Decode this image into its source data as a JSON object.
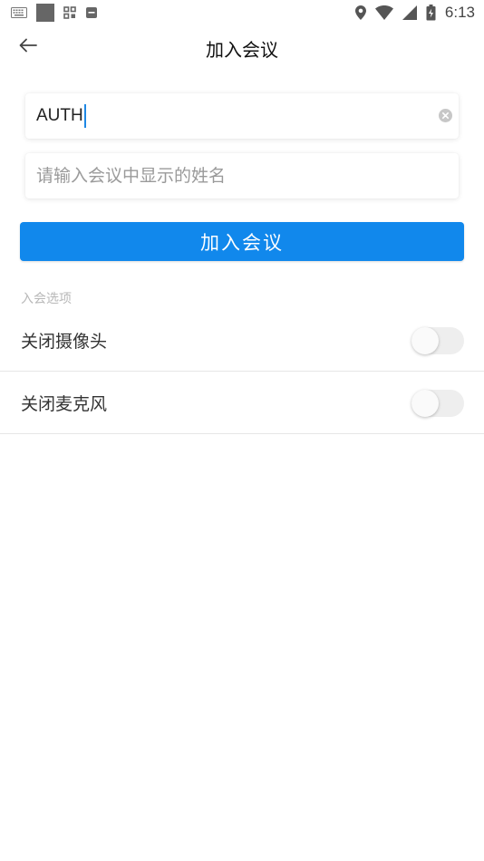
{
  "status_bar": {
    "time": "6:13",
    "icons": [
      "keyboard-icon",
      "square-icon",
      "apps-icon",
      "message-icon",
      "location-icon",
      "wifi-icon",
      "signal-icon",
      "battery-icon"
    ]
  },
  "header": {
    "title": "加入会议",
    "back_icon": "arrow-left-icon"
  },
  "form": {
    "meeting_code": {
      "value": "AUTH"
    },
    "display_name": {
      "value": "",
      "placeholder": "请输入会议中显示的姓名"
    },
    "join_label": "加入会议"
  },
  "options": {
    "section_title": "入会选项",
    "items": [
      {
        "label": "关闭摄像头",
        "enabled": false
      },
      {
        "label": "关闭麦克风",
        "enabled": false
      }
    ]
  },
  "colors": {
    "accent": "#1188ec",
    "cursor": "#1e88e5",
    "toggle_track": "#eeeeee"
  }
}
